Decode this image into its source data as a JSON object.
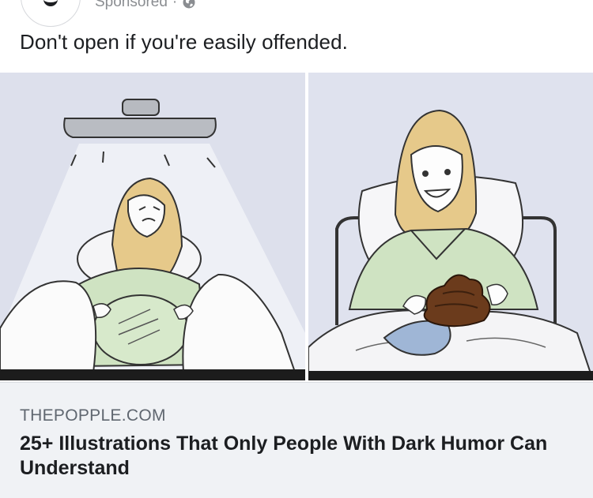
{
  "post": {
    "meta_label": "Sponsored",
    "separator": "·",
    "privacy_icon": "globe-icon",
    "caption": "Don't open if you're easily offended."
  },
  "media": {
    "alt_panels": [
      "delivery-room comic panel",
      "hospital bed comic panel"
    ],
    "colors": {
      "background": "#dfe2ee",
      "gown": "#cfe3c2",
      "hair": "#e6c98a",
      "sheet": "#f4f4f6",
      "poop": "#6b3b1c"
    }
  },
  "link": {
    "domain": "THEPOPPLE.COM",
    "headline": "25+ Illustrations That Only People With Dark Humor Can Understand"
  }
}
